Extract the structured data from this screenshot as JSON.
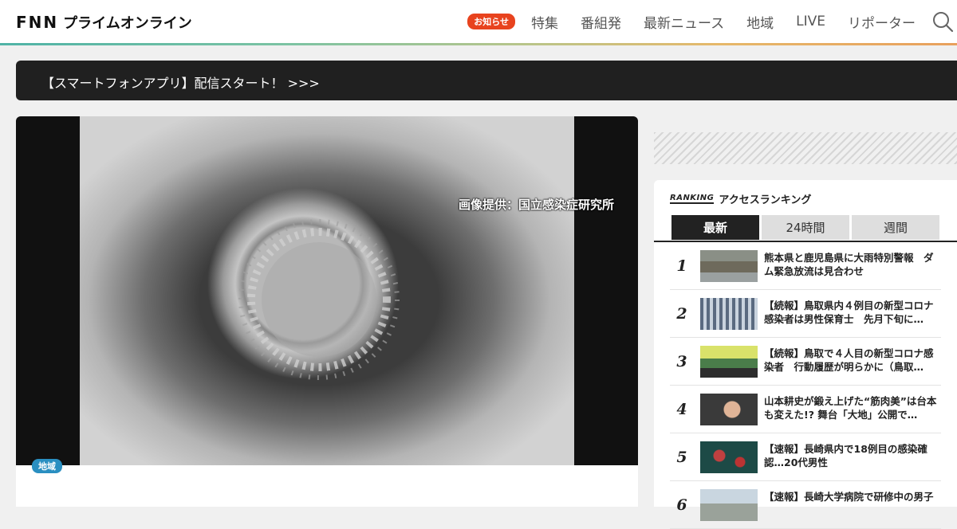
{
  "header": {
    "logo_fnn": "FNN",
    "logo_text": "プライムオンライン",
    "notice_label": "お知らせ",
    "nav": [
      "特集",
      "番組発",
      "最新ニュース",
      "地域",
      "LIVE",
      "リポーター"
    ],
    "search_icon": "search-icon"
  },
  "banner": {
    "text": "【スマートフォンアプリ】配信スタート！ >>>"
  },
  "article": {
    "image_credit": "画像提供：国立感染症研究所",
    "category": "地域"
  },
  "ranking": {
    "badge": "RANKING",
    "title": "アクセスランキング",
    "tabs": [
      "最新",
      "24時間",
      "週間"
    ],
    "active_tab": "最新",
    "items": [
      {
        "rank": "1",
        "text": "熊本県と鹿児島県に大雨特別警報　ダム緊急放流は見合わせ"
      },
      {
        "rank": "2",
        "text": "【続報】鳥取県内４例目の新型コロナ感染者は男性保育士　先月下旬に…"
      },
      {
        "rank": "3",
        "text": "【続報】鳥取で４人目の新型コロナ感染者　行動履歴が明らかに（鳥取…"
      },
      {
        "rank": "4",
        "text": "山本耕史が鍛え上げた“筋肉美”は台本も変えた!? 舞台「大地」公開で…"
      },
      {
        "rank": "5",
        "text": "【速報】長崎県内で18例目の感染確認…20代男性"
      },
      {
        "rank": "6",
        "text": "【速報】長崎大学病院で研修中の男子"
      }
    ]
  },
  "colors": {
    "notice": "#e8431e",
    "category_badge": "#2a8fc1",
    "banner_bg": "#202020",
    "tab_active": "#222222"
  }
}
